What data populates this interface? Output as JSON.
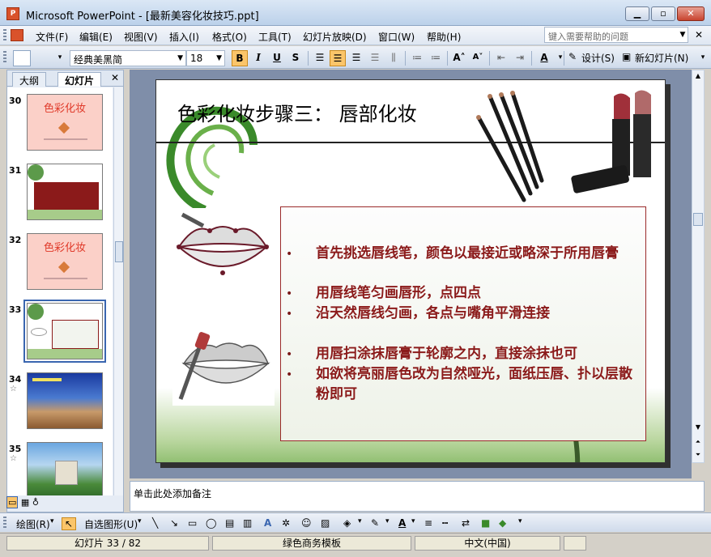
{
  "window": {
    "title": "Microsoft PowerPoint - [最新美容化妆技巧.ppt]",
    "app_icon_text": "P",
    "controls": {
      "minimize": "▁",
      "maximize": "▫",
      "close": "✕"
    }
  },
  "menu": {
    "items": [
      "文件(F)",
      "编辑(E)",
      "视图(V)",
      "插入(I)",
      "格式(O)",
      "工具(T)",
      "幻灯片放映(D)",
      "窗口(W)",
      "帮助(H)"
    ],
    "help_placeholder": "键入需要帮助的问题",
    "doc_close": "✕"
  },
  "toolbar": {
    "font_name": "经典美黑简",
    "font_size": "18",
    "bold": "B",
    "italic": "I",
    "underline": "U",
    "shadow": "S",
    "design_label": "设计(S)",
    "new_slide_label": "新幻灯片(N)",
    "font_color_label": "A"
  },
  "left_panel": {
    "tabs": [
      "大纲",
      "幻灯片"
    ],
    "close": "✕",
    "thumbnails": [
      {
        "num": "30",
        "title": "色彩化妆",
        "star": ""
      },
      {
        "num": "31",
        "title": "",
        "star": ""
      },
      {
        "num": "32",
        "title": "色彩化妆",
        "star": ""
      },
      {
        "num": "33",
        "title": "",
        "star": "",
        "selected": true
      },
      {
        "num": "34",
        "title": "",
        "star": "☆"
      },
      {
        "num": "35",
        "title": "",
        "star": "☆"
      }
    ]
  },
  "slide": {
    "title": "色彩化妆步骤三：   唇部化妆",
    "bullets": [
      "首先挑选唇线笔，颜色以最接近或略深于所用唇膏",
      "用唇线笔匀画唇形，点四点",
      "沿天然唇线匀画，各点与嘴角平滑连接",
      "用唇扫涂抹唇膏于轮廓之内，直接涂抹也可",
      "如欲将亮丽唇色改为自然哑光，面纸压唇、扑以层散粉即可"
    ],
    "bullet_char": "•"
  },
  "notes": {
    "placeholder": "单击此处添加备注"
  },
  "drawbar": {
    "draw_label": "绘图(R)",
    "autoshape_label": "自选图形(U)"
  },
  "status": {
    "slide_info": "幻灯片 33 / 82",
    "template": "绿色商务模板",
    "language": "中文(中国)"
  },
  "colors": {
    "bullet_text": "#8b1a1a",
    "title_bar": "#bcd1ea",
    "workspace": "#7f8ea9"
  }
}
